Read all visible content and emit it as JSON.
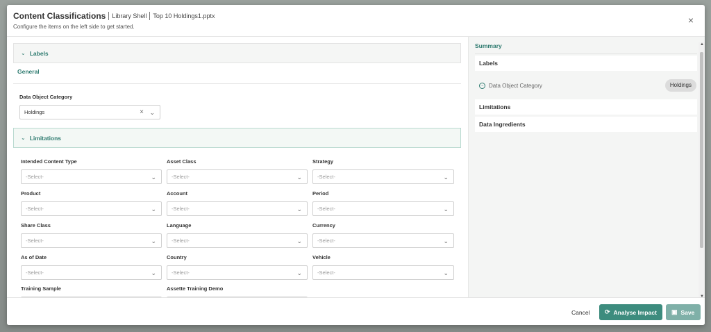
{
  "modal": {
    "title": "Content Classifications",
    "breadcrumb": [
      "Library Shell",
      "Top 10 Holdings1.pptx"
    ],
    "subtitle": "Configure the items on the left side to get started.",
    "close_icon": "close-icon"
  },
  "labels_section": {
    "title": "Labels",
    "tab": "General",
    "field": {
      "label": "Data Object Category",
      "value": "Holdings"
    }
  },
  "limitations_section": {
    "title": "Limitations",
    "placeholder": "-Select-",
    "fields": [
      {
        "label": "Intended Content Type"
      },
      {
        "label": "Asset Class"
      },
      {
        "label": "Strategy"
      },
      {
        "label": "Product"
      },
      {
        "label": "Account"
      },
      {
        "label": "Period"
      },
      {
        "label": "Share Class"
      },
      {
        "label": "Language"
      },
      {
        "label": "Currency"
      },
      {
        "label": "As of Date"
      },
      {
        "label": "Country"
      },
      {
        "label": "Vehicle"
      },
      {
        "label": "Training Sample"
      },
      {
        "label": "Assette Training Demo"
      }
    ]
  },
  "summary": {
    "title": "Summary",
    "labels_heading": "Labels",
    "item_label": "Data Object Category",
    "item_value": "Holdings",
    "limitations_heading": "Limitations",
    "ingredients_heading": "Data Ingredients"
  },
  "footer": {
    "cancel": "Cancel",
    "analyse": "Analyse Impact",
    "save": "Save"
  },
  "colors": {
    "accent": "#2f7b70",
    "button": "#3d8c7e",
    "save": "#7fb0a8"
  }
}
